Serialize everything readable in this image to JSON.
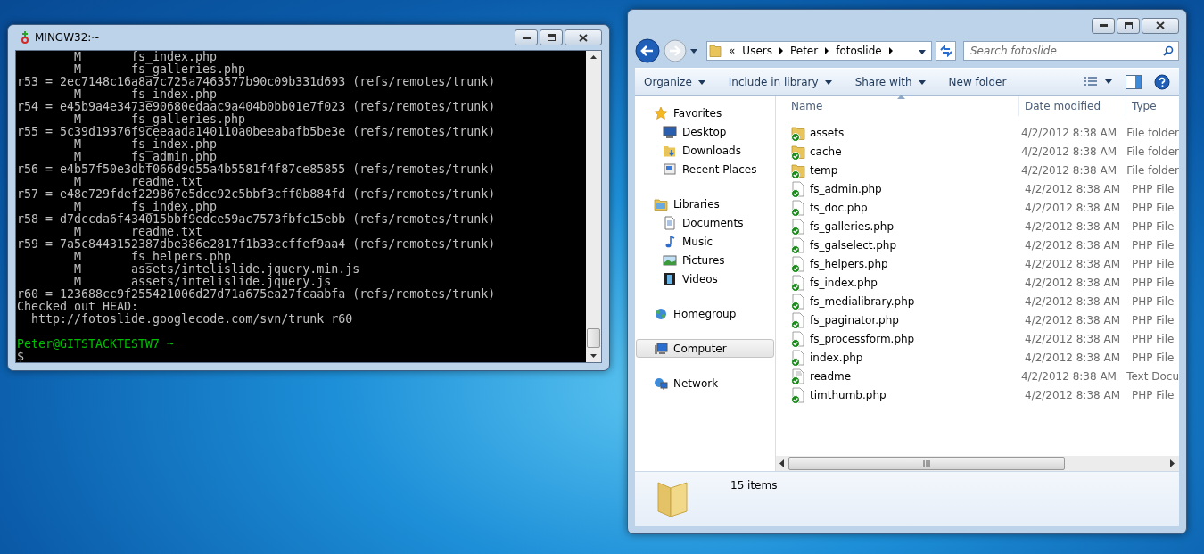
{
  "terminal": {
    "title": "MINGW32:~",
    "lines": [
      {
        "kind": "change",
        "status": "M",
        "file": "fs_index.php"
      },
      {
        "kind": "change",
        "status": "M",
        "file": "fs_galleries.php"
      },
      {
        "kind": "text",
        "text": "r53 = 2ec7148c16a8a7c725a7463577b90c09b331d693 (refs/remotes/trunk)"
      },
      {
        "kind": "change",
        "status": "M",
        "file": "fs_index.php"
      },
      {
        "kind": "text",
        "text": "r54 = e45b9a4e3473e90680edaac9a404b0bb01e7f023 (refs/remotes/trunk)"
      },
      {
        "kind": "change",
        "status": "M",
        "file": "fs_galleries.php"
      },
      {
        "kind": "text",
        "text": "r55 = 5c39d19376f9ceeaada140110a0beeabafb5be3e (refs/remotes/trunk)"
      },
      {
        "kind": "change",
        "status": "M",
        "file": "fs_index.php"
      },
      {
        "kind": "change",
        "status": "M",
        "file": "fs_admin.php"
      },
      {
        "kind": "text",
        "text": "r56 = e4b57f50e3dbf066d9d55a4b5581f4f87ce85855 (refs/remotes/trunk)"
      },
      {
        "kind": "change",
        "status": "M",
        "file": "readme.txt"
      },
      {
        "kind": "text",
        "text": "r57 = e48e729fdef229867e5dcc92c5bbf3cff0b884fd (refs/remotes/trunk)"
      },
      {
        "kind": "change",
        "status": "M",
        "file": "fs_index.php"
      },
      {
        "kind": "text",
        "text": "r58 = d7dccda6f434015bbf9edce59ac7573fbfc15ebb (refs/remotes/trunk)"
      },
      {
        "kind": "change",
        "status": "M",
        "file": "readme.txt"
      },
      {
        "kind": "text",
        "text": "r59 = 7a5c8443152387dbe386e2817f1b33ccffef9aa4 (refs/remotes/trunk)"
      },
      {
        "kind": "change",
        "status": "M",
        "file": "fs_helpers.php"
      },
      {
        "kind": "change",
        "status": "M",
        "file": "assets/intelislide.jquery.min.js"
      },
      {
        "kind": "change",
        "status": "M",
        "file": "assets/intelislide.jquery.js"
      },
      {
        "kind": "text",
        "text": "r60 = 123688cc9f255421006d27d71a675ea27fcaabfa (refs/remotes/trunk)"
      },
      {
        "kind": "text",
        "text": "Checked out HEAD:"
      },
      {
        "kind": "indented",
        "text": "http://fotoslide.googlecode.com/svn/trunk r60"
      }
    ],
    "prompt": {
      "user_host": "Peter@GITSTACKTESTW7",
      "path": "~",
      "symbol": "$"
    }
  },
  "explorer": {
    "breadcrumb": {
      "overflow": "«",
      "parts": [
        "Users",
        "Peter",
        "fotoslide"
      ]
    },
    "search": {
      "placeholder": "Search fotoslide"
    },
    "toolbar": [
      {
        "label": "Organize",
        "dropdown": true
      },
      {
        "label": "Include in library",
        "dropdown": true
      },
      {
        "label": "Share with",
        "dropdown": true
      },
      {
        "label": "New folder",
        "dropdown": false
      }
    ],
    "nav": [
      {
        "label": "Favorites",
        "kind": "favorites",
        "selected": false,
        "children": [
          {
            "label": "Desktop",
            "kind": "desktop",
            "selected": false
          },
          {
            "label": "Downloads",
            "kind": "downloads",
            "selected": false
          },
          {
            "label": "Recent Places",
            "kind": "recent",
            "selected": false
          }
        ]
      },
      {
        "label": "Libraries",
        "kind": "libraries",
        "selected": false,
        "children": [
          {
            "label": "Documents",
            "kind": "documents",
            "selected": false
          },
          {
            "label": "Music",
            "kind": "music",
            "selected": false
          },
          {
            "label": "Pictures",
            "kind": "pictures",
            "selected": false
          },
          {
            "label": "Videos",
            "kind": "videos",
            "selected": false
          }
        ]
      },
      {
        "label": "Homegroup",
        "kind": "homegroup",
        "selected": false
      },
      {
        "label": "Computer",
        "kind": "computer",
        "selected": true
      },
      {
        "label": "Network",
        "kind": "network",
        "selected": false
      }
    ],
    "columns": [
      "Name",
      "Date modified",
      "Type"
    ],
    "files": [
      {
        "name": "assets",
        "date": "4/2/2012 8:38 AM",
        "type": "File folder",
        "kind": "folder"
      },
      {
        "name": "cache",
        "date": "4/2/2012 8:38 AM",
        "type": "File folder",
        "kind": "folder"
      },
      {
        "name": "temp",
        "date": "4/2/2012 8:38 AM",
        "type": "File folder",
        "kind": "folder"
      },
      {
        "name": "fs_admin.php",
        "date": "4/2/2012 8:38 AM",
        "type": "PHP File",
        "kind": "php"
      },
      {
        "name": "fs_doc.php",
        "date": "4/2/2012 8:38 AM",
        "type": "PHP File",
        "kind": "php"
      },
      {
        "name": "fs_galleries.php",
        "date": "4/2/2012 8:38 AM",
        "type": "PHP File",
        "kind": "php"
      },
      {
        "name": "fs_galselect.php",
        "date": "4/2/2012 8:38 AM",
        "type": "PHP File",
        "kind": "php"
      },
      {
        "name": "fs_helpers.php",
        "date": "4/2/2012 8:38 AM",
        "type": "PHP File",
        "kind": "php"
      },
      {
        "name": "fs_index.php",
        "date": "4/2/2012 8:38 AM",
        "type": "PHP File",
        "kind": "php"
      },
      {
        "name": "fs_medialibrary.php",
        "date": "4/2/2012 8:38 AM",
        "type": "PHP File",
        "kind": "php"
      },
      {
        "name": "fs_paginator.php",
        "date": "4/2/2012 8:38 AM",
        "type": "PHP File",
        "kind": "php"
      },
      {
        "name": "fs_processform.php",
        "date": "4/2/2012 8:38 AM",
        "type": "PHP File",
        "kind": "php"
      },
      {
        "name": "index.php",
        "date": "4/2/2012 8:38 AM",
        "type": "PHP File",
        "kind": "php"
      },
      {
        "name": "readme",
        "date": "4/2/2012 8:38 AM",
        "type": "Text Docu",
        "kind": "text"
      },
      {
        "name": "timthumb.php",
        "date": "4/2/2012 8:38 AM",
        "type": "PHP File",
        "kind": "php"
      }
    ],
    "status": "15 items"
  }
}
